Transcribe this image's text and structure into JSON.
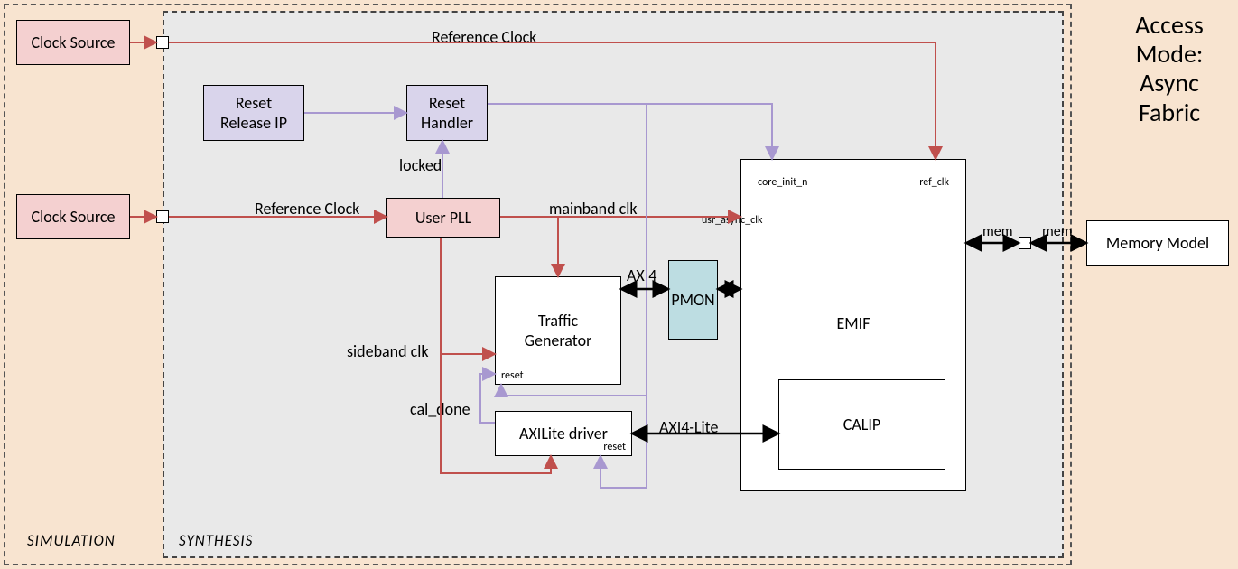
{
  "title_lines": {
    "l1": "Access",
    "l2": "Mode:",
    "l3": "Async",
    "l4": "Fabric"
  },
  "region_labels": {
    "simulation": "SIMULATION",
    "synthesis": "SYNTHESIS"
  },
  "blocks": {
    "clock_source_top": "Clock Source",
    "clock_source_bottom": "Clock Source",
    "reset_release_ip": "Reset\nRelease IP",
    "reset_handler": "Reset\nHandler",
    "user_pll": "User PLL",
    "traffic_generator": "Traffic\nGenerator",
    "axilite_driver": "AXILite driver",
    "pmon": "PMON",
    "emif": "EMIF",
    "calip": "CALIP",
    "memory_model": "Memory Model"
  },
  "wire_labels": {
    "ref_clock_top": "Reference Clock",
    "ref_clock_mid": "Reference Clock",
    "locked": "locked",
    "mainband_clk": "mainband clk",
    "sideband_clk": "sideband clk",
    "cal_done": "cal_done",
    "axi4": "AXI4",
    "axi4_lite": "AXI4-Lite",
    "mem_left": "mem",
    "mem_right": "mem",
    "usr_async_clk": "usr_async_clk",
    "core_init_n": "core_init_n",
    "ref_clk": "ref_clk",
    "reset": "reset"
  }
}
